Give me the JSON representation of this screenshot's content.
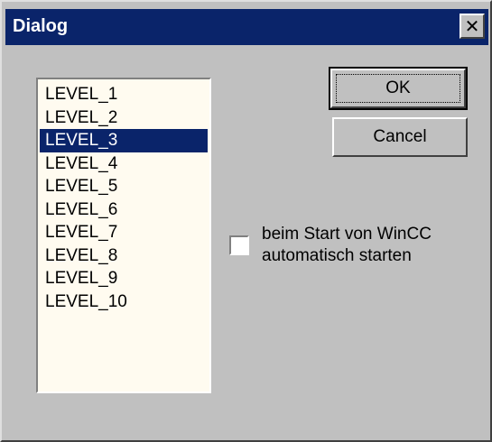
{
  "window": {
    "title": "Dialog",
    "close_glyph": "✕"
  },
  "listbox": {
    "items": [
      "LEVEL_1",
      "LEVEL_2",
      "LEVEL_3",
      "LEVEL_4",
      "LEVEL_5",
      "LEVEL_6",
      "LEVEL_7",
      "LEVEL_8",
      "LEVEL_9",
      "LEVEL_10"
    ],
    "selected_index": 2
  },
  "buttons": {
    "ok_label": "OK",
    "cancel_label": "Cancel"
  },
  "checkbox": {
    "checked": false,
    "label_line1": "beim Start von WinCC",
    "label_line2": "automatisch starten"
  },
  "colors": {
    "titlebar": "#0a246a",
    "face": "#c0c0c0",
    "list_bg": "#fffbf0",
    "selection": "#0a246a"
  }
}
